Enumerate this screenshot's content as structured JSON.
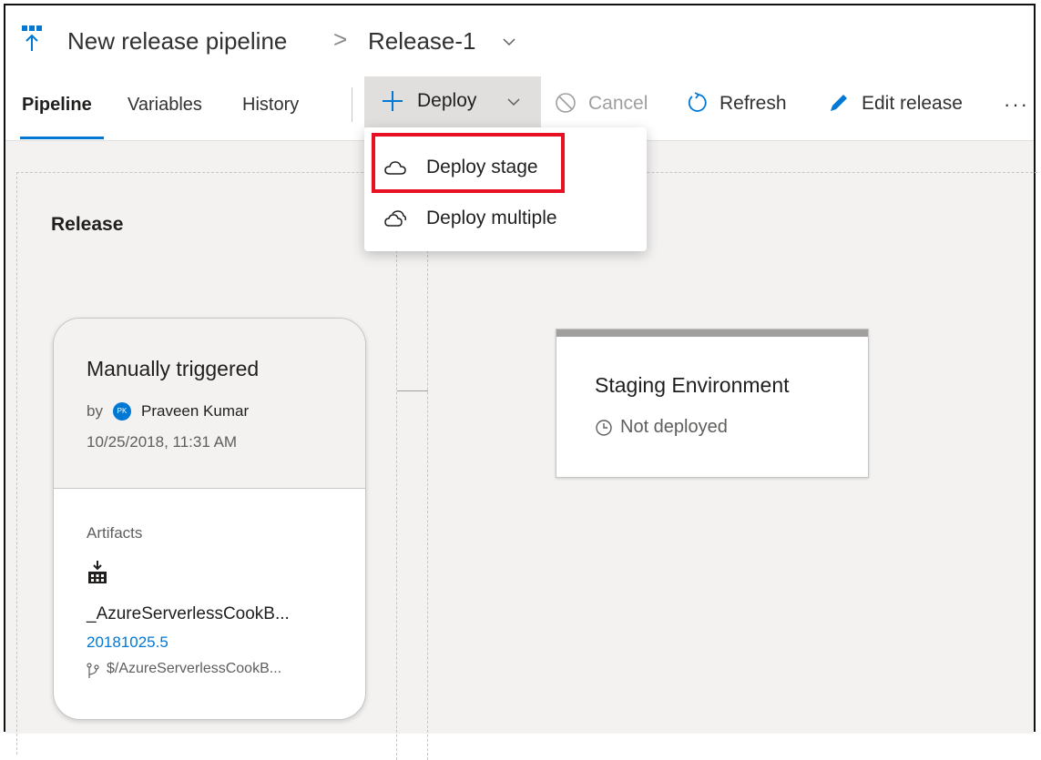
{
  "header": {
    "pipeline_title": "New release pipeline",
    "breadcrumb_separator": ">",
    "release_title": "Release-1"
  },
  "tabs": [
    {
      "label": "Pipeline",
      "active": true
    },
    {
      "label": "Variables",
      "active": false
    },
    {
      "label": "History",
      "active": false
    }
  ],
  "toolbar": {
    "deploy_label": "Deploy",
    "cancel_label": "Cancel",
    "refresh_label": "Refresh",
    "edit_label": "Edit release",
    "more_label": "···"
  },
  "deploy_menu": {
    "items": [
      {
        "label": "Deploy stage",
        "icon": "cloud-icon"
      },
      {
        "label": "Deploy multiple",
        "icon": "cloud-multiple-icon"
      }
    ]
  },
  "release_column": {
    "heading": "Release",
    "card": {
      "trigger": "Manually triggered",
      "by_label": "by",
      "avatar_initials": "PK",
      "user": "Praveen Kumar",
      "date": "10/25/2018, 11:31 AM",
      "artifacts_label": "Artifacts",
      "artifact_name": "_AzureServerlessCookB...",
      "artifact_version": "20181025.5",
      "artifact_branch": "$/AzureServerlessCookB..."
    }
  },
  "stage": {
    "name": "Staging Environment",
    "status": "Not deployed"
  },
  "colors": {
    "accent": "#0078d4",
    "highlight": "#e81123",
    "deploy_button_bg": "#e1dfdd",
    "canvas_bg": "#f3f2f1"
  }
}
